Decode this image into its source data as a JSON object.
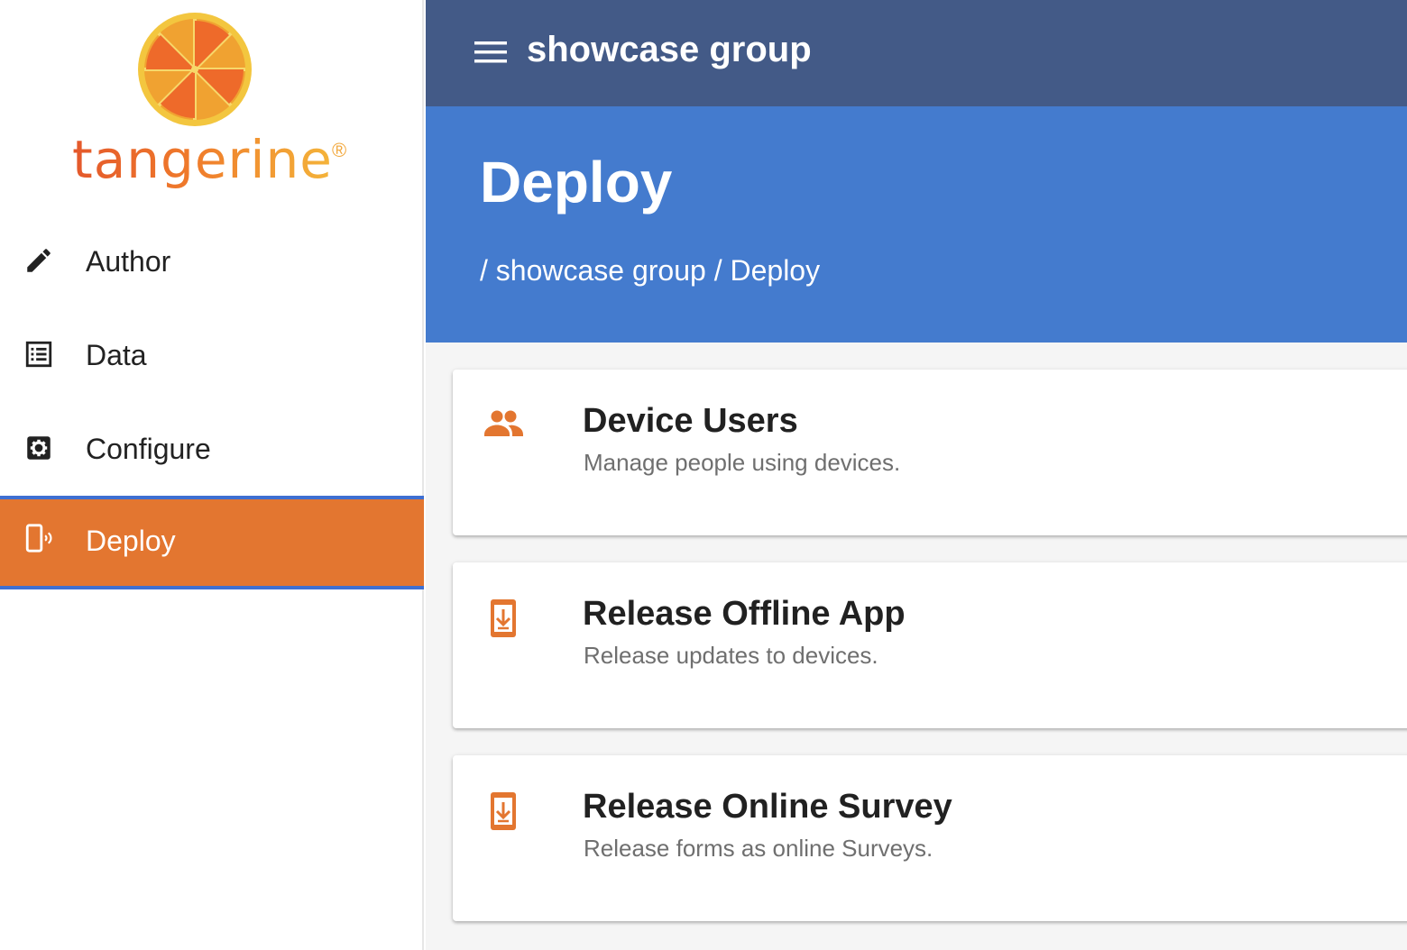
{
  "brand": {
    "name": "tangerine",
    "registered": "®"
  },
  "sidebar": {
    "items": [
      {
        "label": "Author",
        "icon": "pencil-icon"
      },
      {
        "label": "Data",
        "icon": "list-icon"
      },
      {
        "label": "Configure",
        "icon": "settings-icon"
      },
      {
        "label": "Deploy",
        "icon": "phone-signal-icon",
        "active": true
      }
    ]
  },
  "topbar": {
    "title": "showcase group",
    "menu_icon": "hamburger-menu-icon"
  },
  "header": {
    "title": "Deploy",
    "breadcrumb": {
      "sep1": "/",
      "group": "showcase group",
      "sep2": "/",
      "page": "Deploy"
    }
  },
  "cards": [
    {
      "title": "Device Users",
      "subtitle": "Manage people using devices.",
      "icon": "people-icon"
    },
    {
      "title": "Release Offline App",
      "subtitle": "Release updates to devices.",
      "icon": "phone-download-icon"
    },
    {
      "title": "Release Online Survey",
      "subtitle": "Release forms as online Surveys.",
      "icon": "phone-download-icon"
    }
  ],
  "colors": {
    "topbar": "#435a87",
    "header_band": "#447bce",
    "accent_orange": "#e37630",
    "active_border": "#3f6fd1"
  }
}
